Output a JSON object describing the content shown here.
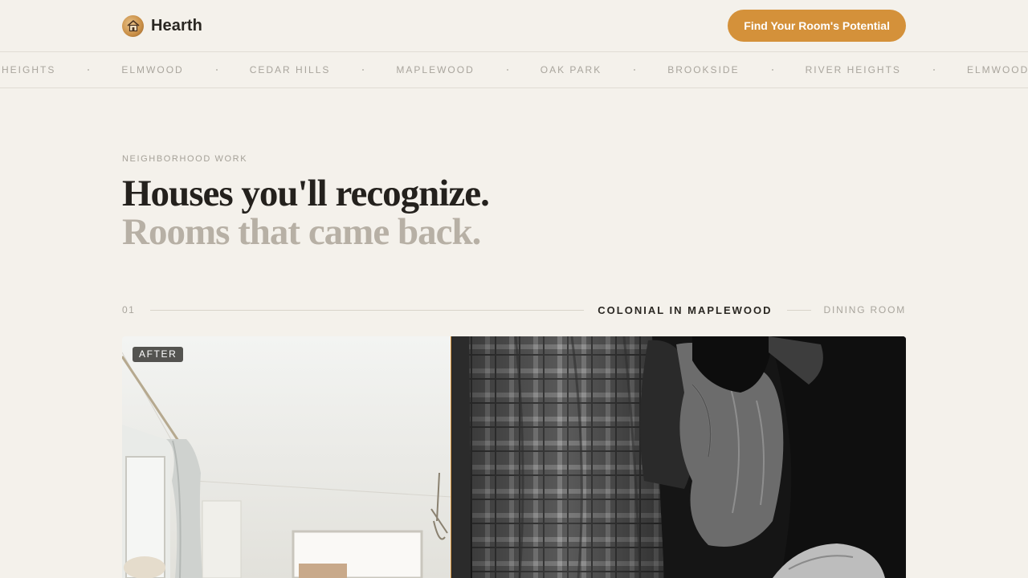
{
  "brand": {
    "name": "Hearth",
    "logo_icon": "house-logo-icon"
  },
  "header": {
    "cta_label": "Find Your Room's Potential"
  },
  "ticker": {
    "items": [
      "River Heights",
      "Elmwood",
      "Cedar Hills",
      "Maplewood",
      "Oak Park",
      "Brookside",
      "River Heights",
      "Elmwood"
    ]
  },
  "section": {
    "eyebrow": "NEIGHBORHOOD WORK",
    "headline_line1": "Houses you'll recognize.",
    "headline_line2": "Rooms that came back."
  },
  "project": {
    "number": "01",
    "title": "COLONIAL IN MAPLEWOOD",
    "room": "DINING ROOM",
    "after_label": "AFTER"
  },
  "colors": {
    "background": "#f4f1eb",
    "accent": "#d4913a",
    "text": "#2a2722",
    "muted": "#a9a59d"
  }
}
